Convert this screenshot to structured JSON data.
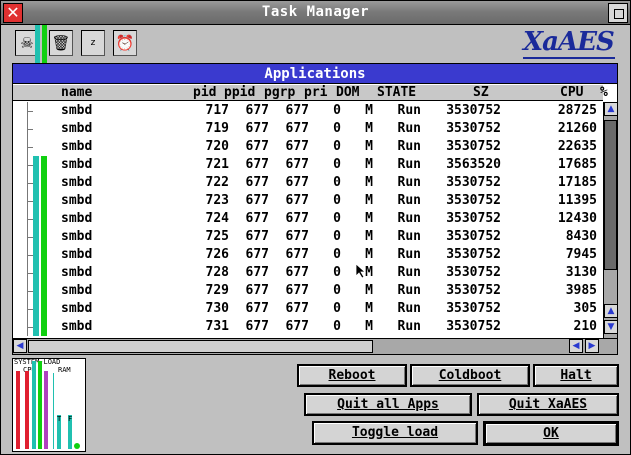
{
  "window": {
    "title": "Task Manager",
    "close_glyph": "✕"
  },
  "toolbar": {
    "icons": [
      "skull-icon",
      "trash-can-icon",
      "sleep-icon",
      "wake-icon"
    ],
    "icon_glyphs": [
      "☠",
      "🗑",
      "z",
      "⏰"
    ],
    "logo": "XaAES"
  },
  "panel": {
    "title": "Applications",
    "columns": [
      "name",
      "pid",
      "ppid",
      "pgrp",
      "pri",
      "DOM",
      "STATE",
      "SZ",
      "CPU",
      "%"
    ],
    "rows": [
      {
        "name": "smbd",
        "pid": "717",
        "ppid": "677",
        "pgrp": "677",
        "pri": "0",
        "dom": "M",
        "state": "Run",
        "sz": "3530752",
        "cpu": "28725",
        "bars": false
      },
      {
        "name": "smbd",
        "pid": "719",
        "ppid": "677",
        "pgrp": "677",
        "pri": "0",
        "dom": "M",
        "state": "Run",
        "sz": "3530752",
        "cpu": "21260",
        "bars": false
      },
      {
        "name": "smbd",
        "pid": "720",
        "ppid": "677",
        "pgrp": "677",
        "pri": "0",
        "dom": "M",
        "state": "Run",
        "sz": "3530752",
        "cpu": "22635",
        "bars": false
      },
      {
        "name": "smbd",
        "pid": "721",
        "ppid": "677",
        "pgrp": "677",
        "pri": "0",
        "dom": "M",
        "state": "Run",
        "sz": "3563520",
        "cpu": "17685",
        "bars": true
      },
      {
        "name": "smbd",
        "pid": "722",
        "ppid": "677",
        "pgrp": "677",
        "pri": "0",
        "dom": "M",
        "state": "Run",
        "sz": "3530752",
        "cpu": "17185",
        "bars": true
      },
      {
        "name": "smbd",
        "pid": "723",
        "ppid": "677",
        "pgrp": "677",
        "pri": "0",
        "dom": "M",
        "state": "Run",
        "sz": "3530752",
        "cpu": "11395",
        "bars": true
      },
      {
        "name": "smbd",
        "pid": "724",
        "ppid": "677",
        "pgrp": "677",
        "pri": "0",
        "dom": "M",
        "state": "Run",
        "sz": "3530752",
        "cpu": "12430",
        "bars": true
      },
      {
        "name": "smbd",
        "pid": "725",
        "ppid": "677",
        "pgrp": "677",
        "pri": "0",
        "dom": "M",
        "state": "Run",
        "sz": "3530752",
        "cpu": "8430",
        "bars": true
      },
      {
        "name": "smbd",
        "pid": "726",
        "ppid": "677",
        "pgrp": "677",
        "pri": "0",
        "dom": "M",
        "state": "Run",
        "sz": "3530752",
        "cpu": "7945",
        "bars": true
      },
      {
        "name": "smbd",
        "pid": "728",
        "ppid": "677",
        "pgrp": "677",
        "pri": "0",
        "dom": "M",
        "state": "Run",
        "sz": "3530752",
        "cpu": "3130",
        "bars": true
      },
      {
        "name": "smbd",
        "pid": "729",
        "ppid": "677",
        "pgrp": "677",
        "pri": "0",
        "dom": "M",
        "state": "Run",
        "sz": "3530752",
        "cpu": "3985",
        "bars": true
      },
      {
        "name": "smbd",
        "pid": "730",
        "ppid": "677",
        "pgrp": "677",
        "pri": "0",
        "dom": "M",
        "state": "Run",
        "sz": "3530752",
        "cpu": "305",
        "bars": true
      },
      {
        "name": "smbd",
        "pid": "731",
        "ppid": "677",
        "pgrp": "677",
        "pri": "0",
        "dom": "M",
        "state": "Run",
        "sz": "3530752",
        "cpu": "210",
        "bars": true
      }
    ],
    "scroll_up_glyph": "▲",
    "scroll_down_glyph": "▼",
    "scroll_left_glyph": "◀",
    "scroll_right_glyph": "▶"
  },
  "load_meter": {
    "title": "SYSTEM-LOAD",
    "cpu_label": "CPU",
    "ram_label": "RAM",
    "ram_total_label": "T",
    "ram_free_label": "F",
    "colors": {
      "red": "#e02030",
      "teal": "#20c0b0",
      "green": "#10d010",
      "purple": "#b040c0"
    }
  },
  "buttons": {
    "reboot": "Reboot",
    "coldboot": "Coldboot",
    "halt": "Halt",
    "quit_all": "Quit all Apps",
    "quit_xaaes": "Quit XaAES",
    "toggle_load": "Toggle load",
    "ok": "OK"
  },
  "colors": {
    "title_bar": "#7a7a7a",
    "panel_title": "#3a3acf",
    "logo": "#1a2a9a",
    "close": "#e03030"
  }
}
